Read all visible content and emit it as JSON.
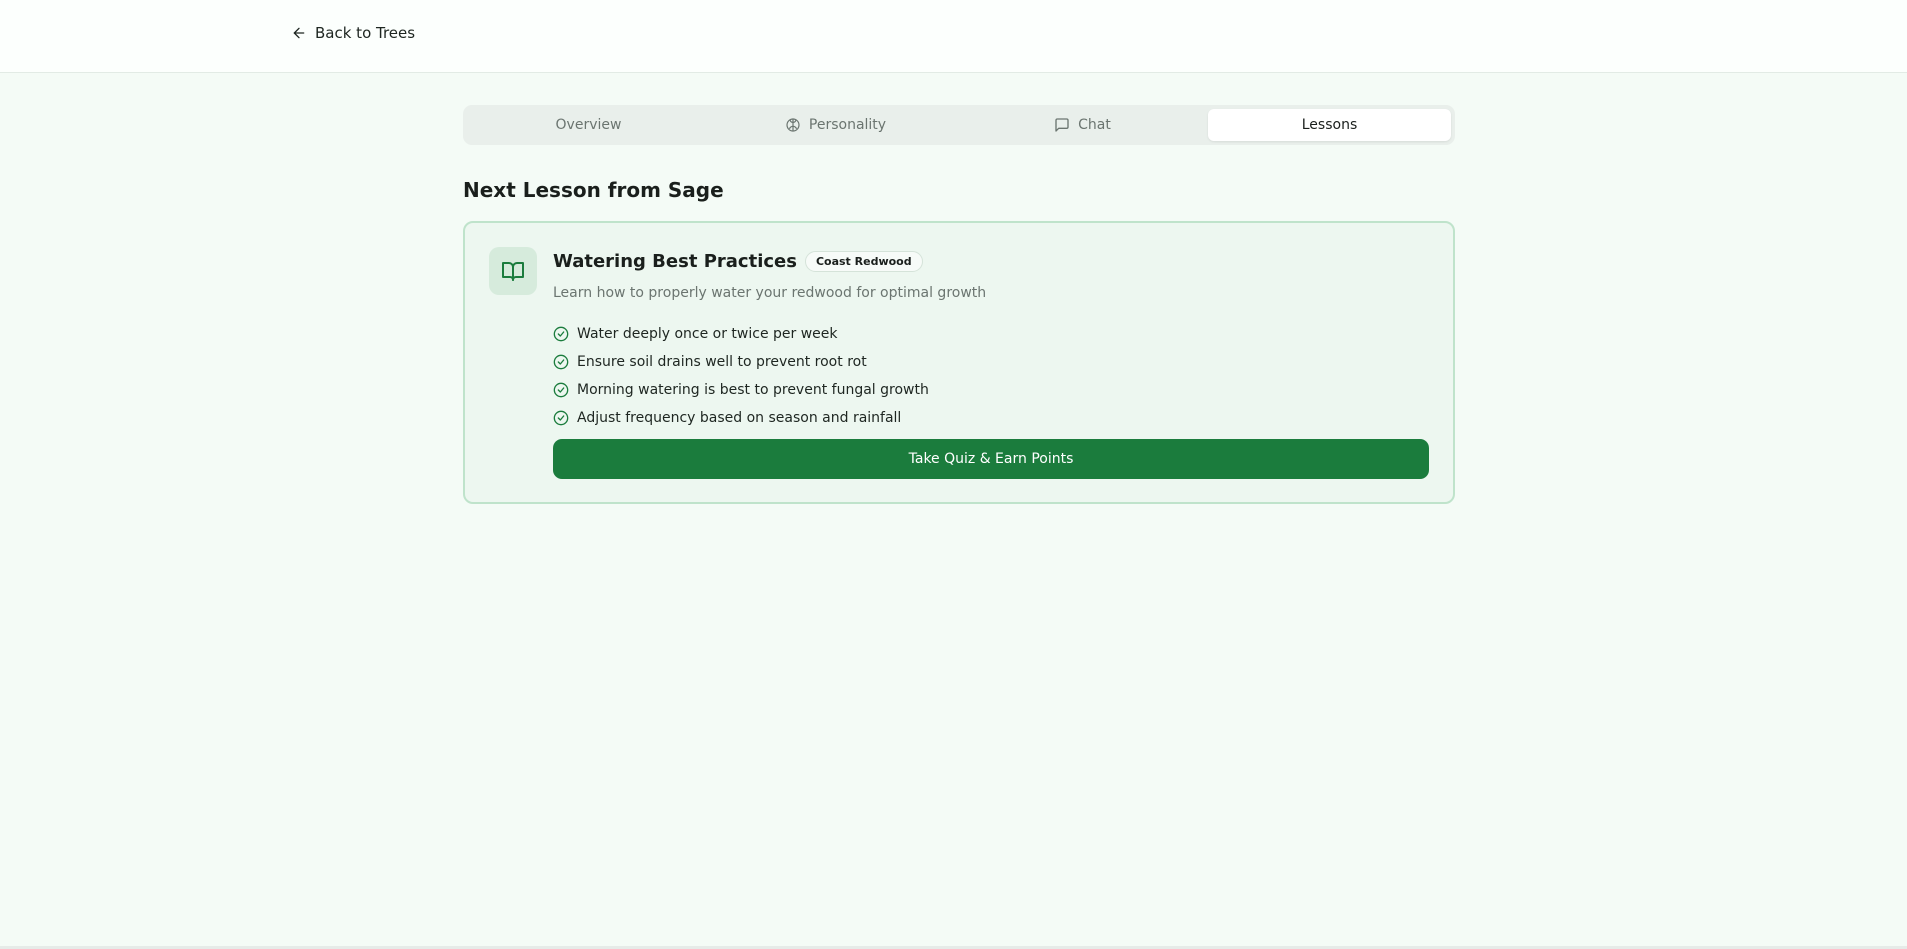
{
  "header": {
    "back_label": "Back to Trees"
  },
  "tabs": [
    {
      "label": "Overview",
      "icon": "none",
      "active": false
    },
    {
      "label": "Personality",
      "icon": "brain-icon",
      "active": false
    },
    {
      "label": "Chat",
      "icon": "chat-bubble-icon",
      "active": false
    },
    {
      "label": "Lessons",
      "icon": "none",
      "active": true
    }
  ],
  "section": {
    "title": "Next Lesson from Sage"
  },
  "lesson": {
    "icon": "book-open-icon",
    "title": "Watering Best Practices",
    "badge": "Coast Redwood",
    "description": "Learn how to properly water your redwood for optimal growth",
    "points": [
      "Water deeply once or twice per week",
      "Ensure soil drains well to prevent root rot",
      "Morning watering is best to prevent fungal growth",
      "Adjust frequency based on season and rainfall"
    ],
    "button_label": "Take Quiz & Earn Points"
  },
  "colors": {
    "brand_green": "#1b7c3d",
    "page_background": "#f4fbf6",
    "card_background": "#edf7f0",
    "card_border": "#bfe3cb"
  }
}
